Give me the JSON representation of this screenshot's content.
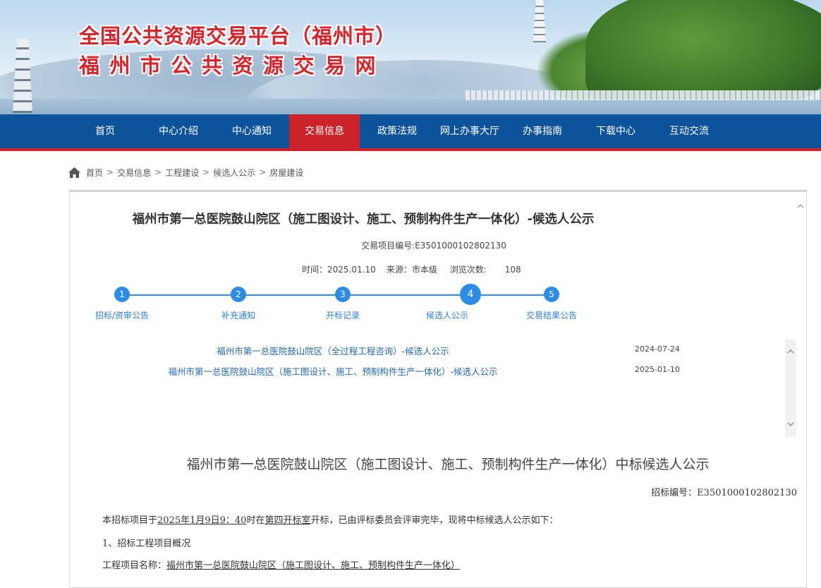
{
  "header": {
    "title_line1": "全国公共资源交易平台（福州市）",
    "title_line2": "福州市公共资源交易网"
  },
  "nav": {
    "items": [
      "首页",
      "中心介绍",
      "中心通知",
      "交易信息",
      "政策法规",
      "网上办事大厅",
      "办事指南",
      "下载中心",
      "互动交流"
    ],
    "active": "交易信息"
  },
  "breadcrumb": [
    "首页",
    "交易信息",
    "工程建设",
    "候选人公示",
    "房屋建设"
  ],
  "doc": {
    "title": "福州市第一总医院鼓山院区（施工图设计、施工、预制构件生产一体化）-候选人公示",
    "code_label": "交易项目编号:",
    "code": "E3501000102802130",
    "time_label": "时间：",
    "time": "2025.01.10",
    "source_label": "来源：",
    "source": "市本级",
    "views_label": "浏览次数:",
    "views": "108"
  },
  "steps": [
    {
      "num": "1",
      "label": "招标/资审公告"
    },
    {
      "num": "2",
      "label": "补充通知"
    },
    {
      "num": "3",
      "label": "开标记录"
    },
    {
      "num": "4",
      "label": "候选人公示"
    },
    {
      "num": "5",
      "label": "交易结果公告"
    }
  ],
  "current_step": 4,
  "related": [
    {
      "title": "福州市第一总医院鼓山院区（全过程工程咨询）-候选人公示",
      "date": "2024-07-24"
    },
    {
      "title": "福州市第一总医院鼓山院区（施工图设计、施工、预制构件生产一体化）-候选人公示",
      "date": "2025-01-10"
    }
  ],
  "announcement": {
    "title": "福州市第一总医院鼓山院区（施工图设计、施工、预制构件生产一体化）中标候选人公示",
    "code_line": "招标编号：E3501000102802130",
    "p1_a": "本招标项目于",
    "p1_date": "2025年1月9日9：40",
    "p1_b": "时在",
    "p1_room": "第四开标室",
    "p1_c": "开标，已由评标委员会评审完毕，现将中标候选人公示如下：",
    "section1": "1、招标工程项目概况",
    "project_name_label": "工程项目名称：",
    "project_name": "福州市第一总医院鼓山院区（施工图设计、施工、预制构件生产一体化）"
  },
  "colors": {
    "nav_bg": "#0d5399",
    "nav_active": "#cc2229",
    "title_red": "#d8242a",
    "step_blue": "#2d8ce6",
    "link_blue": "#2569b3"
  }
}
